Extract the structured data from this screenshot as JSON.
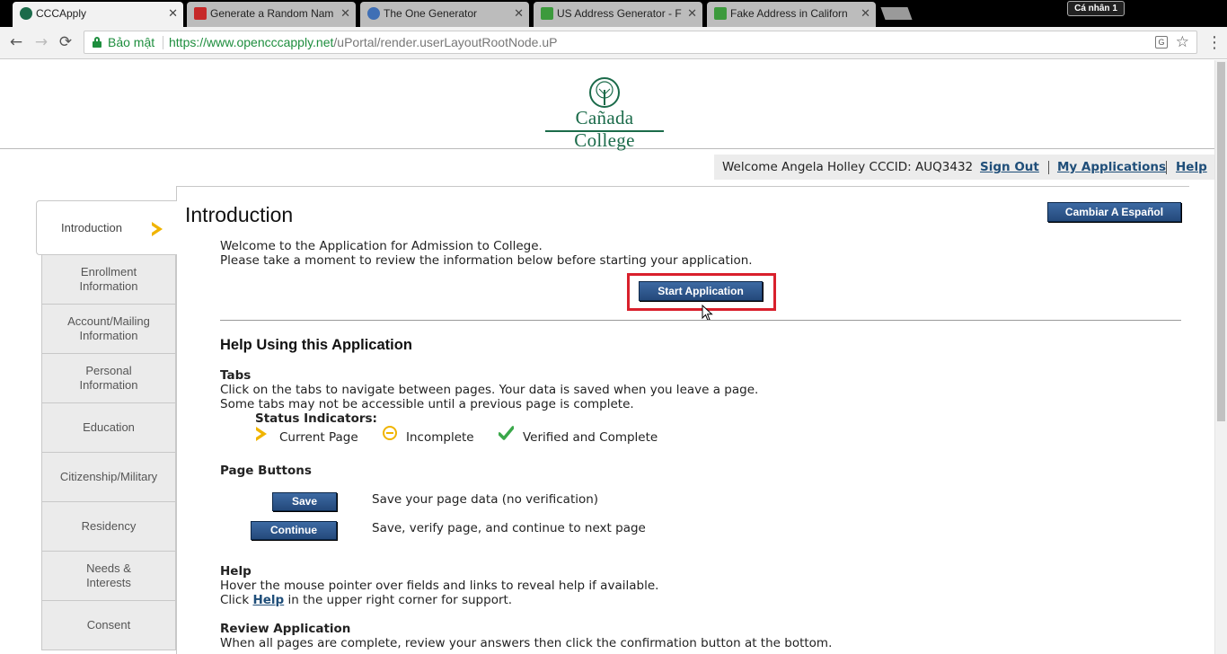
{
  "browser": {
    "tabs": [
      {
        "title": "CCCApply",
        "favicon_color": "#1b6b4a"
      },
      {
        "title": "Generate a Random Nam",
        "favicon_color": "#c62828"
      },
      {
        "title": "The One Generator",
        "favicon_color": "#3f6fb5"
      },
      {
        "title": "US Address Generator - F",
        "favicon_color": "#3c9a3c"
      },
      {
        "title": "Fake Address in Californ",
        "favicon_color": "#3c9a3c"
      }
    ],
    "tab_close_glyph": "✕",
    "profile_label": "Cá nhân 1",
    "secure_label": "Bảo mật",
    "url_host": "https://www.opencccapply.net",
    "url_path": "/uPortal/render.userLayoutRootNode.uP",
    "back_glyph": "←",
    "forward_glyph": "→",
    "reload_glyph": "⟳",
    "star_glyph": "☆",
    "menu_glyph": "⋮",
    "translate_glyph": "G"
  },
  "header": {
    "logo_text": "Cañada College"
  },
  "userbar": {
    "welcome": "Welcome Angela Holley CCCID: AUQ3432",
    "sign_out": "Sign Out",
    "my_applications": "My Applications",
    "help": "Help"
  },
  "sidebar": {
    "items": [
      {
        "line1": "Introduction",
        "line2": ""
      },
      {
        "line1": "Enrollment",
        "line2": "Information"
      },
      {
        "line1": "Account/Mailing",
        "line2": "Information"
      },
      {
        "line1": "Personal",
        "line2": "Information"
      },
      {
        "line1": "Education",
        "line2": ""
      },
      {
        "line1": "Citizenship/Military",
        "line2": ""
      },
      {
        "line1": "Residency",
        "line2": ""
      },
      {
        "line1": "Needs &",
        "line2": "Interests"
      },
      {
        "line1": "Consent",
        "line2": ""
      }
    ]
  },
  "main": {
    "title": "Introduction",
    "spanish_button": "Cambiar A Español",
    "welcome_line1": "Welcome to the Application for Admission to College.",
    "welcome_line2": "Please take a moment to review the information below before starting your application.",
    "start_button": "Start Application",
    "help_heading": "Help Using this Application",
    "tabs_heading": "Tabs",
    "tabs_line1": "Click on the tabs to navigate between pages. Your data is saved when you leave a page.",
    "tabs_line2": "Some tabs may not be accessible until a previous page is complete.",
    "status_heading": "Status Indicators:",
    "status_current": "Current Page",
    "status_incomplete": "Incomplete",
    "status_verified": "Verified and Complete",
    "page_buttons_heading": "Page Buttons",
    "save_button": "Save",
    "save_desc": "Save your page data (no verification)",
    "continue_button": "Continue",
    "continue_desc": "Save, verify page, and continue to next page",
    "help_section_heading": "Help",
    "help_line1": "Hover the mouse pointer over fields and links to reveal help if available.",
    "help_line2_pre": "Click ",
    "help_line2_link": "Help",
    "help_line2_post": " in the upper right corner for support.",
    "review_heading": "Review Application",
    "review_line1": "When all pages are complete, review your answers then click the confirmation button at the bottom."
  }
}
